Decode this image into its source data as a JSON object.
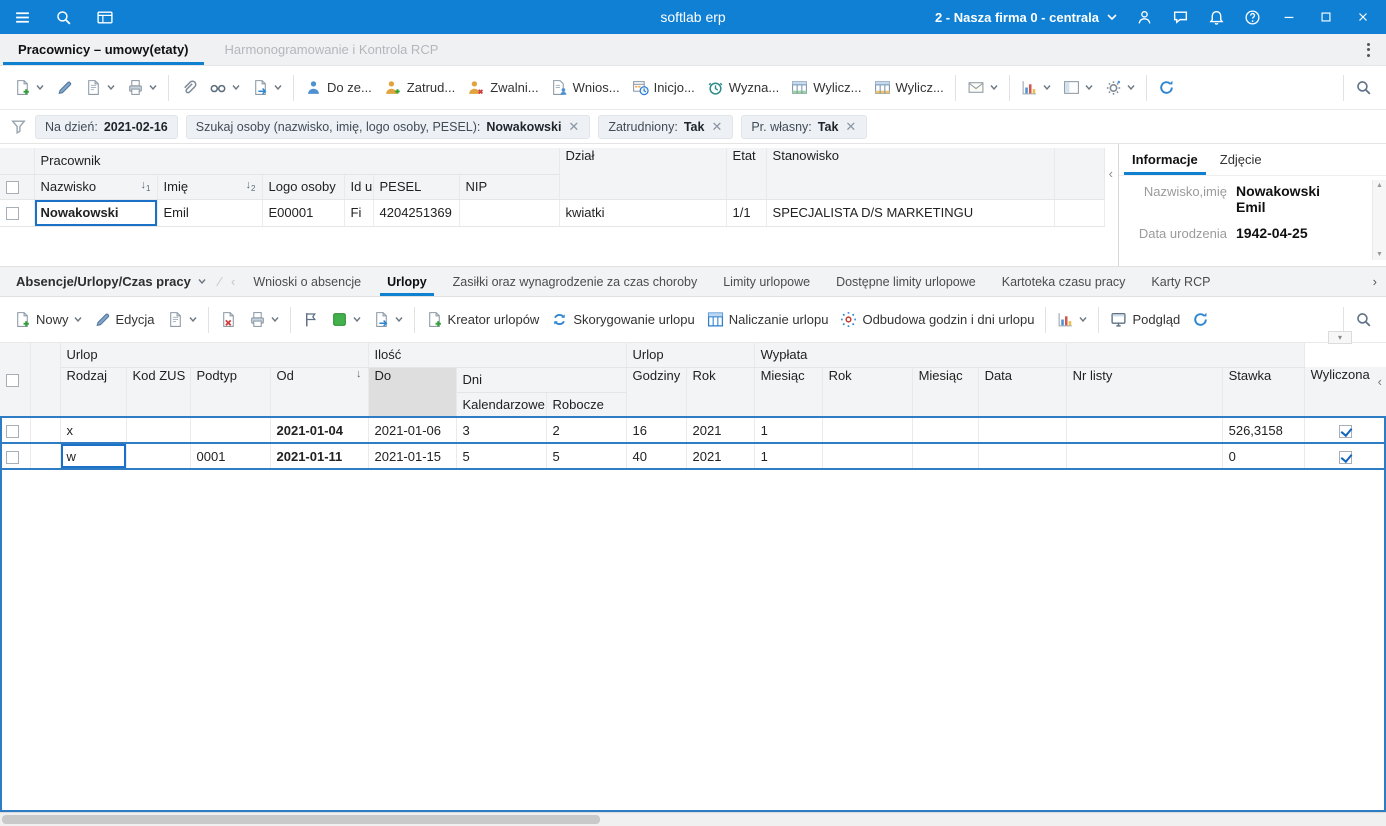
{
  "colors": {
    "accent": "#1080d0",
    "topbar": "#0f80d4",
    "selection": "#2e7cc3",
    "focus": "#1a72c8",
    "hlYellow": "#fbf7cf",
    "hlTeal": "#cde6dd",
    "hlGreen": "#e0ebd2",
    "hlBlue": "#cfe9f4"
  },
  "topbar": {
    "title": "softlab erp",
    "company": "2 - Nasza firma 0 - centrala"
  },
  "tabs": {
    "active": "Pracownicy – umowy(etaty)",
    "inactive": "Harmonogramowanie i Kontrola RCP"
  },
  "toolbar1": {
    "do_ze": "Do ze...",
    "zatrud": "Zatrud...",
    "zwalni": "Zwalni...",
    "wnios": "Wnios...",
    "inicjo": "Inicjo...",
    "wyzna": "Wyzna...",
    "wylicz1": "Wylicz...",
    "wylicz2": "Wylicz..."
  },
  "filters": {
    "date_label": "Na dzień:",
    "date_value": "2021-02-16",
    "search_label": "Szukaj osoby (nazwisko, imię, logo osoby, PESEL):",
    "search_value": "Nowakowski",
    "employed_label": "Zatrudniony:",
    "employed_value": "Tak",
    "own_label": "Pr. własny:",
    "own_value": "Tak"
  },
  "empGrid": {
    "bands": {
      "pracownik": "Pracownik",
      "dzial": "Dział",
      "etat": "Etat",
      "stanowisko": "Stanowisko"
    },
    "cols": {
      "nazwisko": "Nazwisko",
      "imie": "Imię",
      "logo": "Logo osoby",
      "id": "Id u",
      "pesel": "PESEL",
      "nip": "NIP"
    },
    "sort1": "1",
    "sort2": "2",
    "row": {
      "nazwisko": "Nowakowski",
      "imie": "Emil",
      "logo": "E00001",
      "id": "Fi",
      "pesel": "4204251369",
      "nip": "",
      "dzial": "kwiatki",
      "etat": "1/1",
      "stanowisko": "SPECJALISTA D/S MARKETINGU"
    }
  },
  "infoPanel": {
    "tab_info": "Informacje",
    "tab_photo": "Zdjęcie",
    "name_label": "Nazwisko,imię",
    "name_value": "Nowakowski Emil",
    "birth_label": "Data urodzenia",
    "birth_value": "1942-04-25"
  },
  "section2": {
    "selector": "Absencje/Urlopy/Czas pracy",
    "tabs": [
      "Wnioski o absencje",
      "Urlopy",
      "Zasiłki oraz wynagrodzenie za czas choroby",
      "Limity urlopowe",
      "Dostępne limity urlopowe",
      "Kartoteka czasu pracy",
      "Karty RCP"
    ]
  },
  "toolbar2": {
    "nowy": "Nowy",
    "edycja": "Edycja",
    "kreator": "Kreator urlopów",
    "skoryg": "Skorygowanie urlopu",
    "nalicz": "Naliczanie urlopu",
    "odbudowa": "Odbudowa godzin i dni urlopu",
    "podglad": "Podgląd"
  },
  "urlopy": {
    "bands": {
      "urlop1": "Urlop",
      "ilosc": "Ilość",
      "urlop2": "Urlop",
      "wyplata": "Wypłata"
    },
    "cols": {
      "rodzaj": "Rodzaj",
      "kod_zus": "Kod ZUS",
      "podtyp": "Podtyp",
      "od": "Od",
      "do": "Do",
      "dni": "Dni",
      "kalendarzowe": "Kalendarzowe",
      "robocze": "Robocze",
      "godziny": "Godziny",
      "rok": "Rok",
      "miesiac": "Miesiąc",
      "rok2": "Rok",
      "miesiac2": "Miesiąc",
      "data": "Data",
      "nr_listy": "Nr listy",
      "stawka": "Stawka",
      "wyliczona": "Wyliczona"
    },
    "rows": [
      {
        "rodzaj": "x",
        "kod_zus": "",
        "podtyp": "",
        "od": "2021-01-04",
        "do": "2021-01-06",
        "kalendarzowe": "3",
        "robocze": "2",
        "godziny": "16",
        "rok": "2021",
        "miesiac": "1",
        "rok2": "",
        "miesiac2": "",
        "data": "",
        "nr_listy": "",
        "stawka": "526,3158",
        "wyliczona": true
      },
      {
        "rodzaj": "w",
        "kod_zus": "",
        "podtyp": "0001",
        "od": "2021-01-11",
        "do": "2021-01-15",
        "kalendarzowe": "5",
        "robocze": "5",
        "godziny": "40",
        "rok": "2021",
        "miesiac": "1",
        "rok2": "",
        "miesiac2": "",
        "data": "",
        "nr_listy": "",
        "stawka": "0",
        "wyliczona": true
      }
    ]
  }
}
